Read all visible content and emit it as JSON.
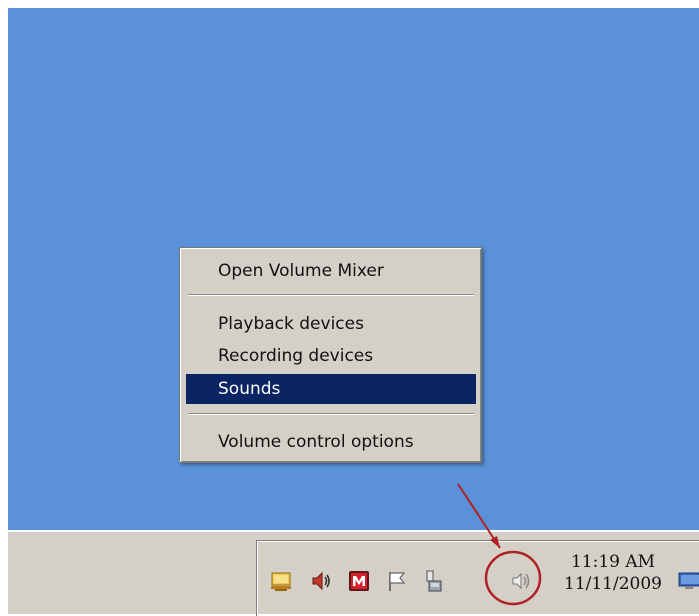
{
  "context_menu": {
    "items": [
      {
        "label": "Open Volume Mixer"
      },
      {
        "label": "Playback devices"
      },
      {
        "label": "Recording devices"
      },
      {
        "label": "Sounds",
        "highlighted": true
      },
      {
        "label": "Volume control options"
      }
    ]
  },
  "tray": {
    "icons": [
      "network-monitor-icon",
      "speaker-icon",
      "m-app-icon",
      "flag-icon",
      "device-icon",
      "volume-icon"
    ],
    "time": "11:19 AM",
    "date": "11/11/2009"
  },
  "annotation": {
    "color": "#b02222",
    "target": "volume-icon"
  },
  "colors": {
    "desktop": "#5b91d8",
    "menu_highlight": "#0a2464",
    "taskbar": "#d4d0c8"
  }
}
